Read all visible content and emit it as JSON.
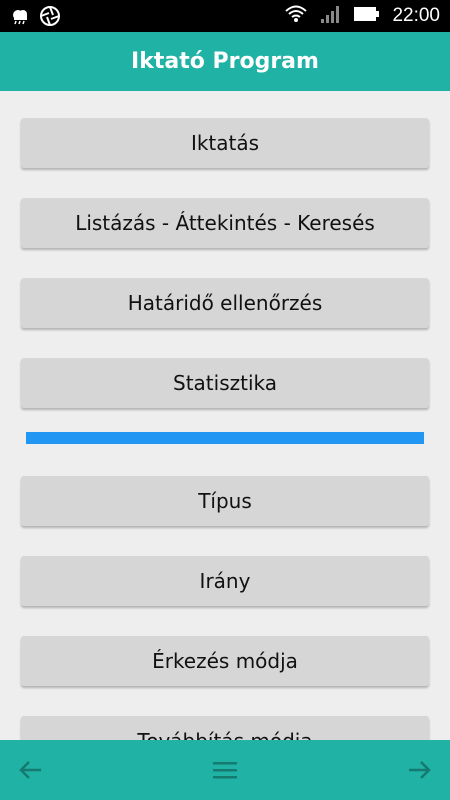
{
  "status": {
    "time": "22:00"
  },
  "appbar": {
    "title": "Iktató Program"
  },
  "menu": {
    "iktatas": "Iktatás",
    "listazas": "Listázás - Áttekintés - Keresés",
    "hatarido": "Határidő ellenőrzés",
    "statisztika": "Statisztika",
    "tipus": "Típus",
    "irany": "Irány",
    "erkezes": "Érkezés módja",
    "tovabbitas": "Továbbítás módja"
  },
  "colors": {
    "accent": "#20b2a4",
    "divider": "#2196f3",
    "button": "#d6d6d6"
  }
}
